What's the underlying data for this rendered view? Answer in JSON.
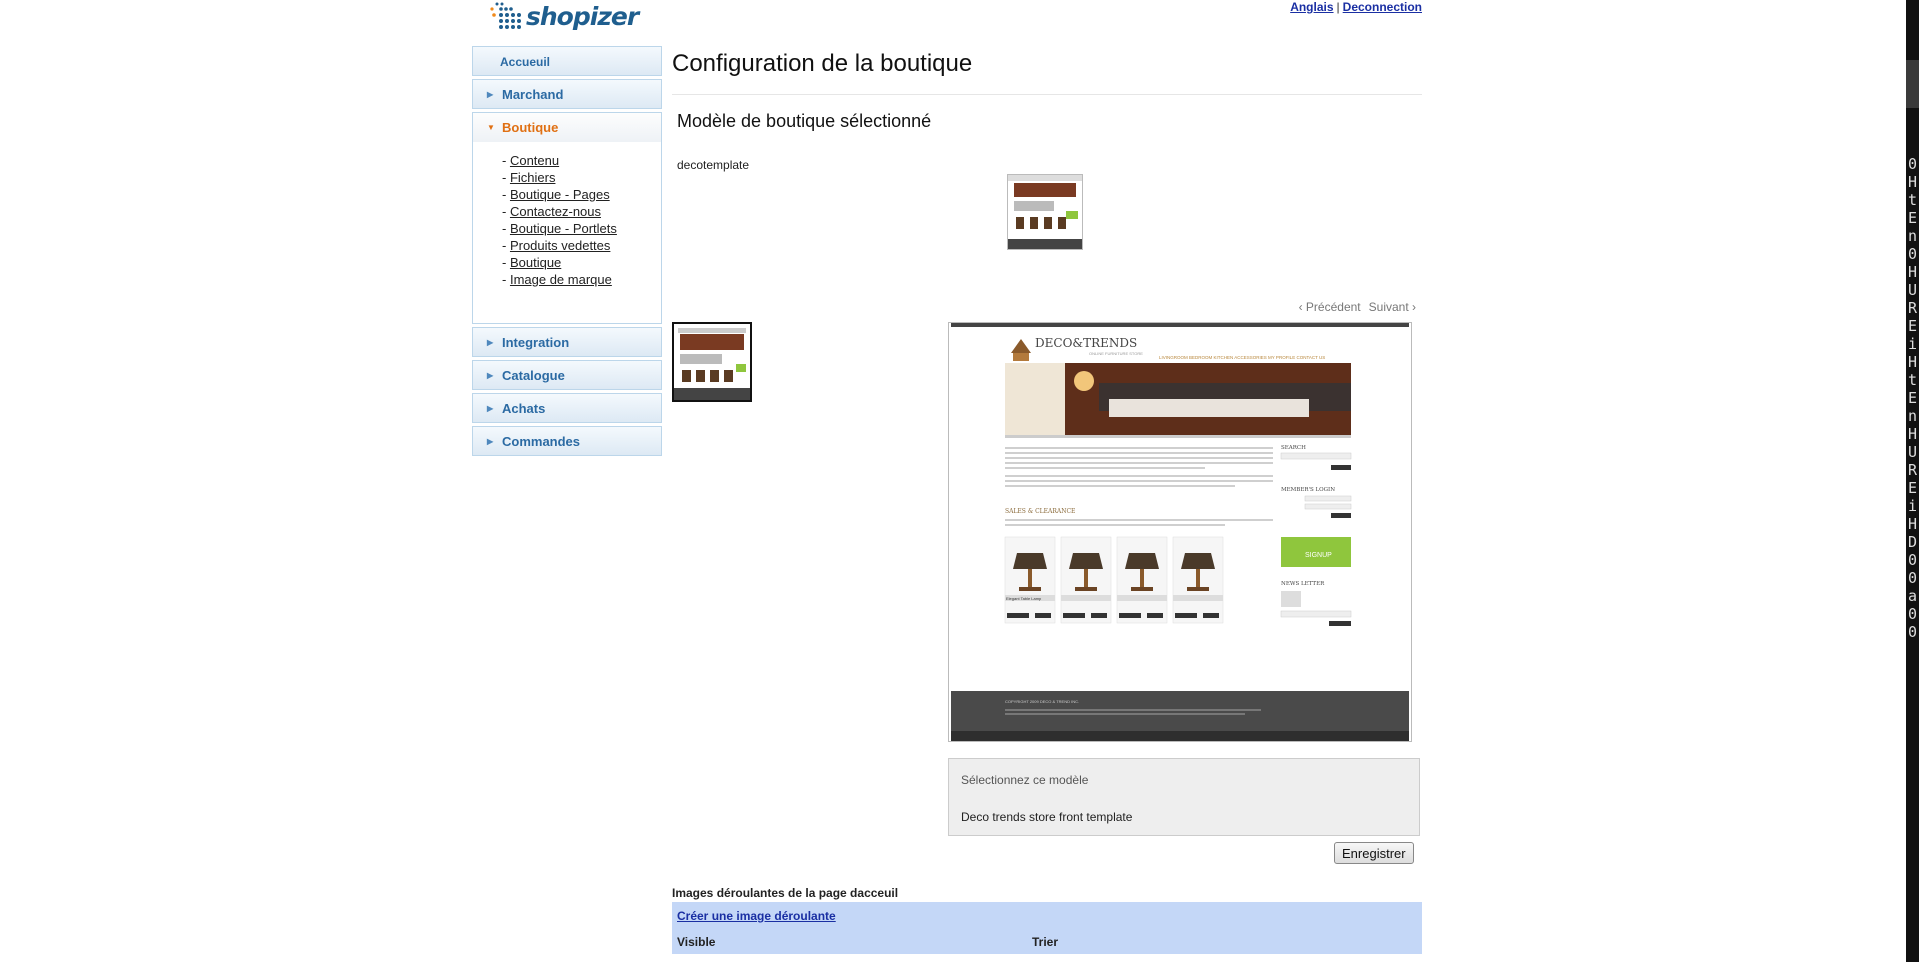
{
  "header": {
    "logo_text": "shopizer",
    "lang_link": "Anglais",
    "separator": "|",
    "logout_link": "Deconnection"
  },
  "sidebar": {
    "home": "Accueuil",
    "sections": {
      "marchand": "Marchand",
      "boutique": "Boutique",
      "integration": "Integration",
      "catalogue": "Catalogue",
      "achats": "Achats",
      "commandes": "Commandes"
    },
    "boutique_items": [
      "Contenu",
      "Fichiers",
      "Boutique - Pages",
      "Contactez-nous",
      "Boutique - Portlets",
      "Produits vedettes",
      "Boutique",
      "Image de marque"
    ],
    "item_prefix": "- "
  },
  "main": {
    "title": "Configuration de la boutique",
    "subtitle": "Modèle de boutique sélectionné",
    "template_name": "decotemplate",
    "prev": "‹ Précédent",
    "next": "Suivant ›",
    "select_label": "Sélectionnez ce modèle",
    "template_desc": "Deco trends store front template",
    "save": "Enregistrer",
    "carousel_title": "Images déroulantes de la page dacceuil",
    "create_link": "Créer une image déroulante",
    "col_visible": "Visible",
    "col_trier": "Trier"
  },
  "preview": {
    "brand": "DECO&TRENDS",
    "tagline": "ONLINE FURNITURE STORE",
    "nav": "LIVINGROOM  BEDROOM  KITCHEN  ACCESSORIES  MY PROFILE  CONTACT US",
    "search": "SEARCH",
    "member_login": "MEMBER'S LOGIN",
    "sales": "SALES & CLEARANCE",
    "signup": "SIGNUP",
    "newsletter": "NEWS LETTER",
    "product_name": "Elegant Table Lamp",
    "copyright": "COPYRIGHT 2009 DECO & TREND INC."
  },
  "colors": {
    "accent_blue": "#2b6aa3",
    "active_orange": "#e07013",
    "link_blue": "#1a2fa3",
    "table_bg": "#c4d7f7"
  },
  "strip_chars": "0HtEn0HUR.EiHtEnHUR.EiH.D00a00"
}
